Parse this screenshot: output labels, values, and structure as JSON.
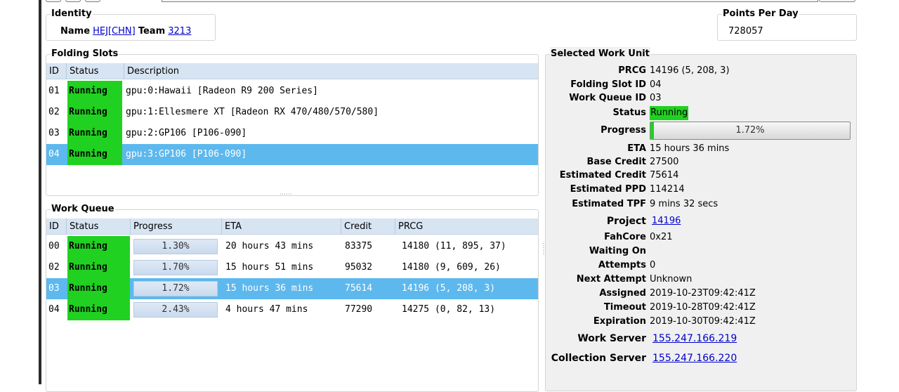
{
  "identity": {
    "legend": "Identity",
    "name_label": "Name",
    "name_value": "HEJ[CHN]",
    "team_label": "Team",
    "team_value": "3213"
  },
  "ppd": {
    "legend": "Points Per Day",
    "value": "728057"
  },
  "folding_slots": {
    "legend": "Folding Slots",
    "columns": [
      "ID",
      "Status",
      "Description"
    ],
    "rows": [
      {
        "id": "01",
        "status": "Running",
        "description": "gpu:0:Hawaii [Radeon R9 200 Series]"
      },
      {
        "id": "02",
        "status": "Running",
        "description": "gpu:1:Ellesmere XT [Radeon RX 470/480/570/580]"
      },
      {
        "id": "03",
        "status": "Running",
        "description": "gpu:2:GP106 [P106-090]"
      },
      {
        "id": "04",
        "status": "Running",
        "description": "gpu:3:GP106 [P106-090]"
      }
    ],
    "selected_index": 3
  },
  "work_queue": {
    "legend": "Work Queue",
    "columns": [
      "ID",
      "Status",
      "Progress",
      "ETA",
      "Credit",
      "PRCG"
    ],
    "rows": [
      {
        "id": "00",
        "status": "Running",
        "progress": "1.30%",
        "progress_value": 1.3,
        "eta": "20 hours 43 mins",
        "credit": "83375",
        "prcg": "14180 (11, 895, 37)"
      },
      {
        "id": "02",
        "status": "Running",
        "progress": "1.70%",
        "progress_value": 1.7,
        "eta": "15 hours 51 mins",
        "credit": "95032",
        "prcg": "14180 (9, 609, 26)"
      },
      {
        "id": "03",
        "status": "Running",
        "progress": "1.72%",
        "progress_value": 1.72,
        "eta": "15 hours 36 mins",
        "credit": "75614",
        "prcg": "14196 (5, 208, 3)"
      },
      {
        "id": "04",
        "status": "Running",
        "progress": "2.43%",
        "progress_value": 2.43,
        "eta": "4 hours 47 mins",
        "credit": "77290",
        "prcg": "14275 (0, 82, 13)"
      }
    ],
    "selected_index": 2
  },
  "selected_work_unit": {
    "legend": "Selected Work Unit",
    "prcg_label": "PRCG",
    "prcg": "14196 (5, 208, 3)",
    "slot_label": "Folding Slot ID",
    "slot": "04",
    "queue_label": "Work Queue ID",
    "queue": "03",
    "status_label": "Status",
    "status": "Running",
    "progress_label": "Progress",
    "progress": "1.72%",
    "progress_value": 1.72,
    "eta_label": "ETA",
    "eta": "15 hours 36 mins",
    "base_credit_label": "Base Credit",
    "base_credit": "27500",
    "est_credit_label": "Estimated Credit",
    "est_credit": "75614",
    "est_ppd_label": "Estimated PPD",
    "est_ppd": "114214",
    "est_tpf_label": "Estimated TPF",
    "est_tpf": "9 mins 32 secs",
    "project_label": "Project",
    "project": "14196",
    "fahcore_label": "FahCore",
    "fahcore": "0x21",
    "waiting_label": "Waiting On",
    "waiting": "",
    "attempts_label": "Attempts",
    "attempts": "0",
    "next_attempt_label": "Next Attempt",
    "next_attempt": "Unknown",
    "assigned_label": "Assigned",
    "assigned": "2019-10-23T09:42:41Z",
    "timeout_label": "Timeout",
    "timeout": "2019-10-28T09:42:41Z",
    "expiration_label": "Expiration",
    "expiration": "2019-10-30T09:42:41Z",
    "work_server_label": "Work Server",
    "work_server": "155.247.166.219",
    "collection_server_label": "Collection Server",
    "collection_server": "155.247.166.220"
  },
  "colors": {
    "running": "#21d121",
    "selected_row": "#5db8ee",
    "header": "#d7e4f2"
  }
}
